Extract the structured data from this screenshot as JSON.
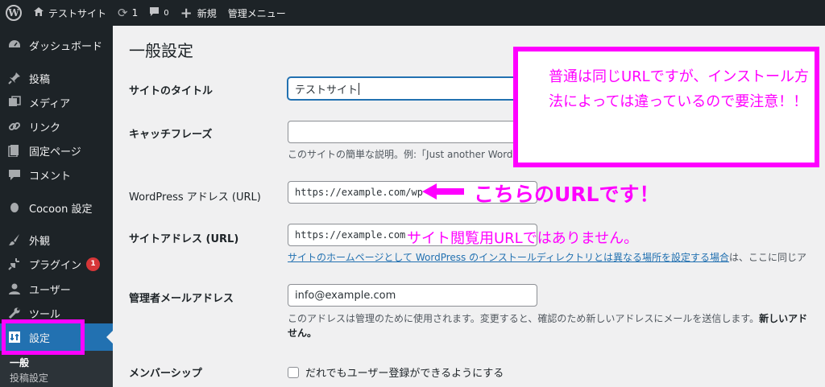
{
  "adminbar": {
    "site_name": "テストサイト",
    "updates_count": "1",
    "comments_count": "0",
    "new_label": "新規",
    "manage_menu": "管理メニュー"
  },
  "sidebar": {
    "items": [
      {
        "label": "ダッシュボード",
        "icon": "dashboard-icon"
      },
      {
        "label": "投稿",
        "icon": "pin-icon"
      },
      {
        "label": "メディア",
        "icon": "media-icon"
      },
      {
        "label": "リンク",
        "icon": "link-icon"
      },
      {
        "label": "固定ページ",
        "icon": "page-icon"
      },
      {
        "label": "コメント",
        "icon": "comment-icon"
      },
      {
        "label": "Cocoon 設定",
        "icon": "cocoon-icon"
      },
      {
        "label": "外観",
        "icon": "brush-icon"
      },
      {
        "label": "プラグイン",
        "icon": "plugin-icon",
        "badge": "1"
      },
      {
        "label": "ユーザー",
        "icon": "user-icon"
      },
      {
        "label": "ツール",
        "icon": "wrench-icon"
      },
      {
        "label": "設定",
        "icon": "settings-icon",
        "current": true
      }
    ],
    "submenu": {
      "current": "一般",
      "next": "投稿設定"
    }
  },
  "main": {
    "title": "一般設定",
    "fields": {
      "site_title": {
        "label": "サイトのタイトル",
        "value": "テストサイト"
      },
      "tagline": {
        "label": "キャッチフレーズ",
        "value": "",
        "description": "このサイトの簡単な説明。例:「Just another WordPress site」"
      },
      "wp_address": {
        "label": "WordPress アドレス (URL)",
        "value": "https://example.com/wp"
      },
      "site_address": {
        "label": "サイトアドレス (URL)",
        "value": "https://example.com",
        "description_link": "サイトのホームページとして WordPress のインストールディレクトリとは異なる場所を設定する場合",
        "description_rest": "は、ここに同じア"
      },
      "admin_email": {
        "label": "管理者メールアドレス",
        "value": "info@example.com",
        "description_line1": "このアドレスは管理のために使用されます。変更すると、確認のため新しいアドレスにメールを送信します。",
        "description_bold": "新しいアド",
        "description_line2": "せん。"
      },
      "membership": {
        "label": "メンバーシップ",
        "checkbox_label": "だれでもユーザー登録ができるようにする"
      }
    }
  },
  "annotations": {
    "note": "普通は同じURLですが、インストール方法によっては違っているので要注意！！",
    "arrow_label": "こちらのURLです！",
    "site_url_label": "サイト閲覧用URLではありません。",
    "color": "#ff00ff"
  }
}
